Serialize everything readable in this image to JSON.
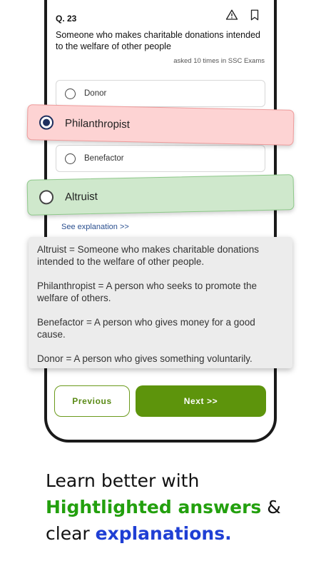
{
  "question": {
    "number": "Q. 23",
    "text": "Someone who makes charitable donations intended to the welfare of other people",
    "asked": "asked 10 times in SSC Exams",
    "icons": [
      "warning-icon",
      "bookmark-icon"
    ]
  },
  "options": [
    {
      "label": "Donor",
      "selected": false
    },
    {
      "label": "Philanthropist",
      "selected": true,
      "highlight": "wrong",
      "color": "#fdd3d3"
    },
    {
      "label": "Benefactor",
      "selected": false
    },
    {
      "label": "Altruist",
      "selected": false,
      "highlight": "correct",
      "color": "#cfe8cc"
    }
  ],
  "see_explanation": "See explanation >>",
  "explanation": [
    "Altruist = Someone who makes charitable donations intended to the welfare of other people.",
    "Philanthropist = A person who seeks to promote the welfare of others.",
    "Benefactor = A person who gives money for a good cause.",
    "Donor = A person who gives something voluntarily."
  ],
  "buttons": {
    "previous": "Previous",
    "next": "Next >>"
  },
  "tagline": {
    "line1": "Learn better with",
    "highlight_green": "Hightlighted answers",
    "amp": " &",
    "line3_prefix": "clear ",
    "highlight_blue": "explanations."
  },
  "colors": {
    "accent_green": "#5d940c",
    "tag_green": "#23a00e",
    "tag_blue": "#1f3fd4"
  }
}
